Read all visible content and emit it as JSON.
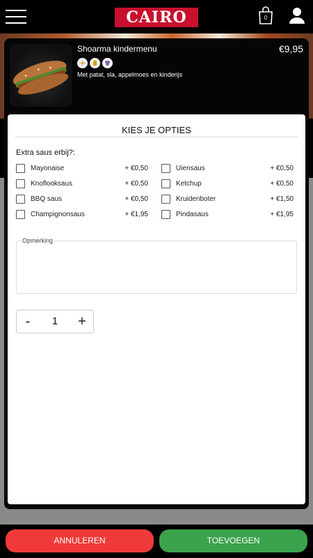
{
  "header": {
    "logo_text": "CAIRO",
    "cart_count": "0"
  },
  "product": {
    "name": "Shoarma kindermenu",
    "price": "€9,95",
    "description": "Met patat, sla, appelmoes en kinderijs",
    "badges": [
      "flower-icon",
      "wheat-icon",
      "grapes-icon"
    ]
  },
  "options": {
    "title": "KIES JE OPTIES",
    "section_label": "Extra saus erbij?:",
    "items": [
      {
        "label": "Mayonaise",
        "price": "+ €0,50",
        "checked": false
      },
      {
        "label": "Uiensaus",
        "price": "+ €0,50",
        "checked": false
      },
      {
        "label": "Knoflooksaus",
        "price": "+ €0,50",
        "checked": false
      },
      {
        "label": "Ketchup",
        "price": "+ €0,50",
        "checked": false
      },
      {
        "label": "BBQ saus",
        "price": "+ €0,50",
        "checked": false
      },
      {
        "label": "Kruidenboter",
        "price": "+ €1,50",
        "checked": false
      },
      {
        "label": "Champignonsaus",
        "price": "+ €1,95",
        "checked": false
      },
      {
        "label": "Pindasaus",
        "price": "+ €1,95",
        "checked": false
      }
    ],
    "remark_label": "Opmerking",
    "remark_value": ""
  },
  "quantity": {
    "minus": "-",
    "value": "1",
    "plus": "+"
  },
  "footer": {
    "cancel_label": "ANNULEREN",
    "add_label": "TOEVOEGEN"
  },
  "colors": {
    "cancel": "#f03a3a",
    "add": "#3ba34d",
    "brand": "#c8102e"
  }
}
